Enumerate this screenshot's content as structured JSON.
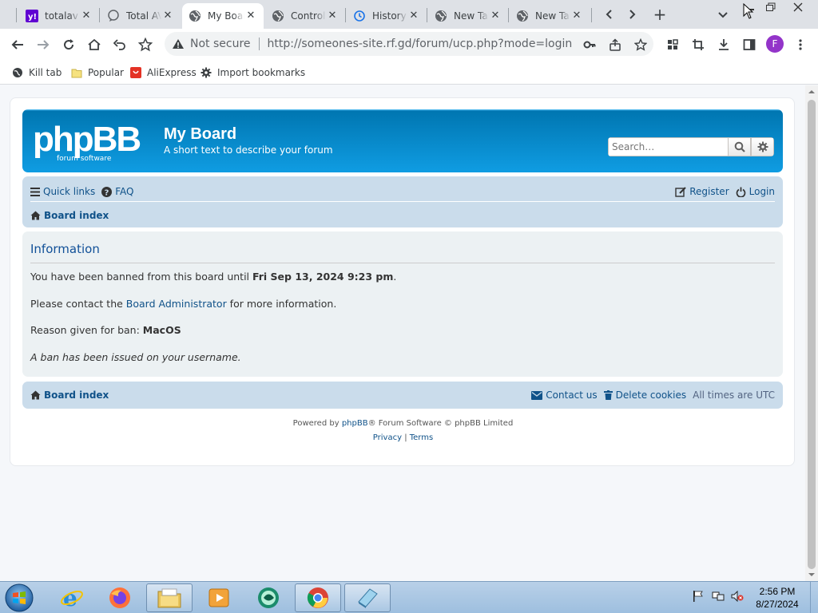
{
  "browser": {
    "tabs": [
      {
        "title": "totalav",
        "favicon": "yahoo-icon"
      },
      {
        "title": "Total AV",
        "favicon": "chat-bubble-icon"
      },
      {
        "title": "My Board",
        "favicon": "globe-icon",
        "active": true
      },
      {
        "title": "Control Panel",
        "favicon": "globe-icon"
      },
      {
        "title": "History",
        "favicon": "history-icon"
      },
      {
        "title": "New Tab",
        "favicon": "globe-icon"
      },
      {
        "title": "New Tab",
        "favicon": "globe-icon"
      }
    ],
    "tab_close_glyph": "✕",
    "new_tab_glyph": "+",
    "security_label": "Not secure",
    "url": "http://someones-site.rf.gd/forum/ucp.php?mode=login",
    "profile_initial": "F",
    "profile_color": "#9334c9",
    "bookmarks": [
      {
        "label": "Kill tab",
        "icon": "gear-icon"
      },
      {
        "label": "Popular",
        "icon": "folder-icon"
      },
      {
        "label": "AliExpress",
        "icon": "aliexpress-icon"
      },
      {
        "label": "Import bookmarks",
        "icon": "gear-icon"
      }
    ]
  },
  "forum": {
    "logo_text": "phpBB",
    "logo_subtext": "forum  software",
    "site_title": "My Board",
    "site_description": "A short text to describe your forum",
    "search_placeholder": "Search…",
    "nav": {
      "quick_links": "Quick links",
      "faq": "FAQ",
      "register": "Register",
      "login": "Login",
      "board_index": "Board index"
    },
    "info": {
      "heading": "Information",
      "ban_prefix": "You have been banned from this board until ",
      "ban_until": "Fri Sep 13, 2024 9:23 pm",
      "ban_suffix": ".",
      "contact_prefix": "Please contact the ",
      "contact_link": "Board Administrator",
      "contact_suffix": " for more information.",
      "reason_prefix": "Reason given for ban: ",
      "reason": "MacOS",
      "issued_note": "A ban has been issued on your username."
    },
    "footer": {
      "board_index": "Board index",
      "contact_us": "Contact us",
      "delete_cookies": "Delete cookies",
      "timezone": "All times are UTC"
    },
    "copyright": {
      "prefix": "Powered by ",
      "phpbb": "phpBB",
      "middle": "® Forum Software © phpBB Limited",
      "privacy": "Privacy",
      "sep": " | ",
      "terms": "Terms"
    },
    "colors": {
      "link": "#105289",
      "header_blue": "#12A3EB",
      "navbar": "#cadceb",
      "panel": "#ecf1f3"
    }
  },
  "taskbar": {
    "time": "2:56 PM",
    "date": "8/27/2024",
    "pinned": [
      "internet-explorer-icon",
      "firefox-icon",
      "file-explorer-icon",
      "media-player-icon",
      "green-app-icon",
      "chrome-icon",
      "notepad-icon"
    ]
  }
}
